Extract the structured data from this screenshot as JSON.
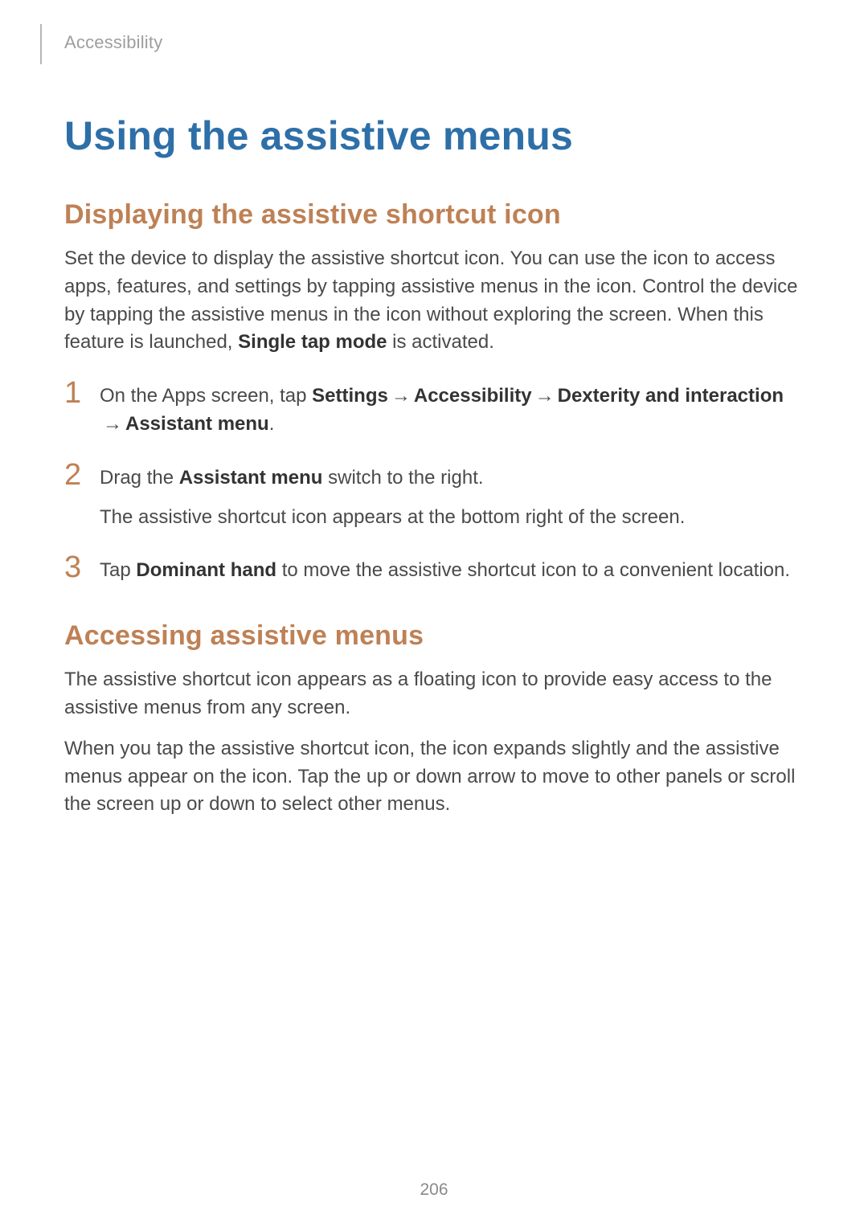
{
  "header": {
    "section_label": "Accessibility"
  },
  "title": "Using the assistive menus",
  "section1": {
    "heading": "Displaying the assistive shortcut icon",
    "intro_pre": "Set the device to display the assistive shortcut icon. You can use the icon to access apps, features, and settings by tapping assistive menus in the icon. Control the device by tapping the assistive menus in the icon without exploring the screen. When this feature is launched, ",
    "intro_bold": "Single tap mode",
    "intro_post": " is activated.",
    "steps": {
      "1": {
        "num": "1",
        "pre": "On the Apps screen, tap ",
        "b1": "Settings",
        "a1": " → ",
        "b2": "Accessibility",
        "a2": " → ",
        "b3": "Dexterity and interaction",
        "a3": " → ",
        "b4": "Assistant menu",
        "post": "."
      },
      "2": {
        "num": "2",
        "line1_pre": "Drag the ",
        "line1_bold": "Assistant menu",
        "line1_post": " switch to the right.",
        "line2": "The assistive shortcut icon appears at the bottom right of the screen."
      },
      "3": {
        "num": "3",
        "pre": "Tap ",
        "bold": "Dominant hand",
        "post": " to move the assistive shortcut icon to a convenient location."
      }
    }
  },
  "section2": {
    "heading": "Accessing assistive menus",
    "para1": "The assistive shortcut icon appears as a floating icon to provide easy access to the assistive menus from any screen.",
    "para2": "When you tap the assistive shortcut icon, the icon expands slightly and the assistive menus appear on the icon. Tap the up or down arrow to move to other panels or scroll the screen up or down to select other menus."
  },
  "page_number": "206"
}
